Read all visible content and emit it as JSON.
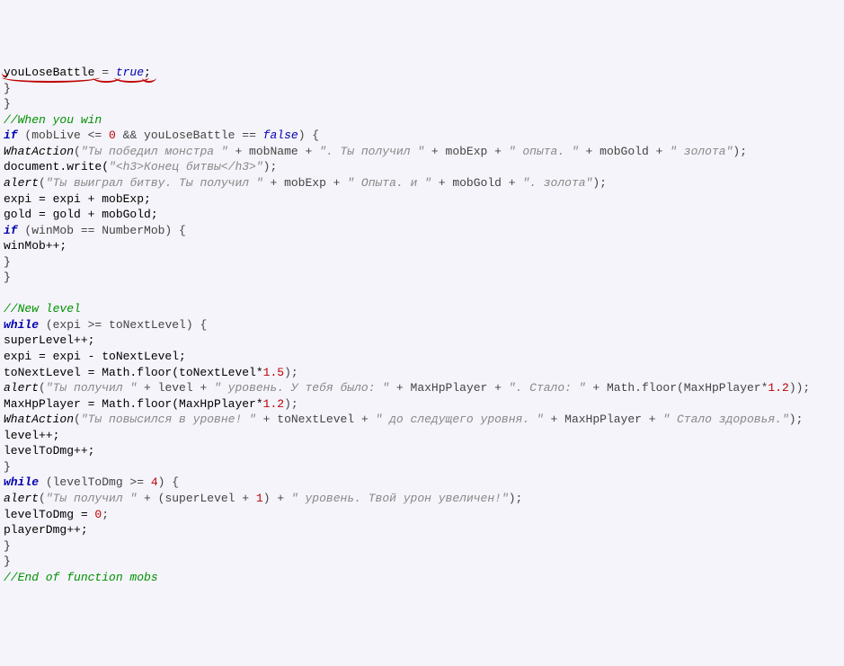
{
  "lines": [
    [
      {
        "cls": "underline",
        "t": ""
      },
      {
        "cls": "id underline",
        "t": "youLoseBattle"
      },
      {
        "cls": "op underline",
        "t": " = "
      },
      {
        "cls": "bool underline",
        "t": "true"
      },
      {
        "cls": "id underline",
        "t": ";"
      }
    ],
    [
      {
        "cls": "br",
        "t": "}"
      }
    ],
    [
      {
        "cls": "br",
        "t": "}"
      }
    ],
    [
      {
        "cls": "cmt",
        "t": "//When you win"
      }
    ],
    [
      {
        "cls": "k",
        "t": "if"
      },
      {
        "cls": "op",
        "t": " (mobLive <= "
      },
      {
        "cls": "num",
        "t": "0"
      },
      {
        "cls": "op",
        "t": " && youLoseBattle == "
      },
      {
        "cls": "bool",
        "t": "false"
      },
      {
        "cls": "op",
        "t": ") {"
      }
    ],
    [
      {
        "cls": "fn",
        "t": "WhatAction"
      },
      {
        "cls": "op",
        "t": "("
      },
      {
        "cls": "str",
        "t": "\"Ты победил монстра \""
      },
      {
        "cls": "op",
        "t": " + mobName + "
      },
      {
        "cls": "str",
        "t": "\". Ты получил \""
      },
      {
        "cls": "op",
        "t": " + mobExp + "
      },
      {
        "cls": "str",
        "t": "\" опыта. \""
      },
      {
        "cls": "op",
        "t": " + mobGold + "
      },
      {
        "cls": "str",
        "t": "\" золота\""
      },
      {
        "cls": "op",
        "t": ");"
      }
    ],
    [
      {
        "cls": "id",
        "t": "document.write("
      },
      {
        "cls": "str",
        "t": "\"<h3>Конец битвы</h3>\""
      },
      {
        "cls": "op",
        "t": ");"
      }
    ],
    [
      {
        "cls": "fn",
        "t": "alert"
      },
      {
        "cls": "op",
        "t": "("
      },
      {
        "cls": "str",
        "t": "\"Ты выиграл битву. Ты получил \""
      },
      {
        "cls": "op",
        "t": " + mobExp + "
      },
      {
        "cls": "str",
        "t": "\" Опыта. и \""
      },
      {
        "cls": "op",
        "t": " + mobGold + "
      },
      {
        "cls": "str",
        "t": "\". золота\""
      },
      {
        "cls": "op",
        "t": ");"
      }
    ],
    [
      {
        "cls": "id",
        "t": "expi = expi + mobExp;"
      }
    ],
    [
      {
        "cls": "id",
        "t": "gold = gold + mobGold;"
      }
    ],
    [
      {
        "cls": "k",
        "t": "if"
      },
      {
        "cls": "op",
        "t": " (winMob == NumberMob) {"
      }
    ],
    [
      {
        "cls": "id",
        "t": "winMob++;"
      }
    ],
    [
      {
        "cls": "br",
        "t": "}"
      }
    ],
    [
      {
        "cls": "br",
        "t": "}"
      }
    ],
    [
      {
        "cls": "id",
        "t": ""
      }
    ],
    [
      {
        "cls": "cmt",
        "t": "//New level"
      }
    ],
    [
      {
        "cls": "k",
        "t": "while"
      },
      {
        "cls": "op",
        "t": " (expi >= toNextLevel) {"
      }
    ],
    [
      {
        "cls": "id",
        "t": "superLevel++;"
      }
    ],
    [
      {
        "cls": "id",
        "t": "expi = expi - toNextLevel;"
      }
    ],
    [
      {
        "cls": "id",
        "t": "toNextLevel = Math.floor(toNextLevel*"
      },
      {
        "cls": "num",
        "t": "1.5"
      },
      {
        "cls": "op",
        "t": ");"
      }
    ],
    [
      {
        "cls": "fn",
        "t": "alert"
      },
      {
        "cls": "op",
        "t": "("
      },
      {
        "cls": "str",
        "t": "\"Ты получил \""
      },
      {
        "cls": "op",
        "t": " + level + "
      },
      {
        "cls": "str",
        "t": "\" уровень. У тебя было: \""
      },
      {
        "cls": "op",
        "t": " + MaxHpPlayer + "
      },
      {
        "cls": "str",
        "t": "\". Стало: \""
      },
      {
        "cls": "op",
        "t": " + Math.floor(MaxHpPlayer*"
      },
      {
        "cls": "num",
        "t": "1.2"
      },
      {
        "cls": "op",
        "t": "));"
      }
    ],
    [
      {
        "cls": "id",
        "t": "MaxHpPlayer = Math.floor(MaxHpPlayer*"
      },
      {
        "cls": "num",
        "t": "1.2"
      },
      {
        "cls": "op",
        "t": ");"
      }
    ],
    [
      {
        "cls": "fn",
        "t": "WhatAction"
      },
      {
        "cls": "op",
        "t": "("
      },
      {
        "cls": "str",
        "t": "\"Ты повысился в уровне! \""
      },
      {
        "cls": "op",
        "t": " + toNextLevel + "
      },
      {
        "cls": "str",
        "t": "\" до следущего уровня. \""
      },
      {
        "cls": "op",
        "t": " + MaxHpPlayer + "
      },
      {
        "cls": "str",
        "t": "\" Стало здоровья.\""
      },
      {
        "cls": "op",
        "t": ");"
      }
    ],
    [
      {
        "cls": "id",
        "t": "level++;"
      }
    ],
    [
      {
        "cls": "id",
        "t": "levelToDmg++;"
      }
    ],
    [
      {
        "cls": "br",
        "t": "}"
      }
    ],
    [
      {
        "cls": "k",
        "t": "while"
      },
      {
        "cls": "op",
        "t": " (levelToDmg >= "
      },
      {
        "cls": "num",
        "t": "4"
      },
      {
        "cls": "op",
        "t": ") {"
      }
    ],
    [
      {
        "cls": "fn",
        "t": "alert"
      },
      {
        "cls": "op",
        "t": "("
      },
      {
        "cls": "str",
        "t": "\"Ты получил \""
      },
      {
        "cls": "op",
        "t": " + (superLevel + "
      },
      {
        "cls": "num",
        "t": "1"
      },
      {
        "cls": "op",
        "t": ") + "
      },
      {
        "cls": "str",
        "t": "\" уровень. Твой урон увеличен!\""
      },
      {
        "cls": "op",
        "t": ");"
      }
    ],
    [
      {
        "cls": "id",
        "t": "levelToDmg = "
      },
      {
        "cls": "num",
        "t": "0"
      },
      {
        "cls": "op",
        "t": ";"
      }
    ],
    [
      {
        "cls": "id",
        "t": "playerDmg++;"
      }
    ],
    [
      {
        "cls": "br",
        "t": "}"
      }
    ],
    [
      {
        "cls": "br",
        "t": "}"
      }
    ],
    [
      {
        "cls": "cmt",
        "t": "//End of function mobs"
      }
    ]
  ]
}
